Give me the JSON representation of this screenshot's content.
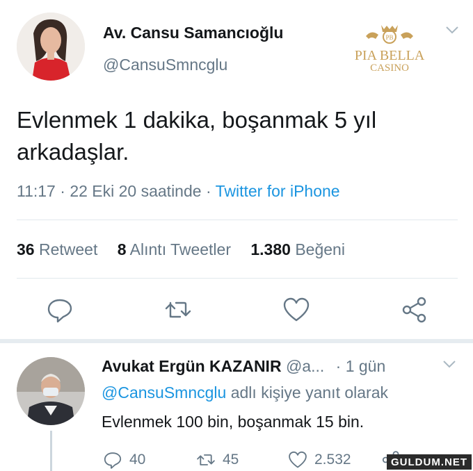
{
  "colors": {
    "link": "#1b95e0",
    "secondary": "#657786",
    "primary": "#14171a",
    "divider": "#e1e8ed"
  },
  "tweet": {
    "author_name": "Av. Cansu Samancıoğlu",
    "author_handle": "@CansuSmncglu",
    "text": "Evlenmek 1 dakika, boşanmak 5 yıl arkadaşlar.",
    "time": "11:17",
    "date": "22 Eki 20 saatinde",
    "separator": "·",
    "source": "Twitter for iPhone",
    "stats": {
      "retweet_count": "36",
      "retweet_label": "Retweet",
      "quote_count": "8",
      "quote_label": "Alıntı Tweetler",
      "like_count": "1.380",
      "like_label": "Beğeni"
    },
    "actions": [
      {
        "icon": "reply-icon"
      },
      {
        "icon": "retweet-icon"
      },
      {
        "icon": "like-icon"
      },
      {
        "icon": "share-icon"
      }
    ]
  },
  "logo": {
    "top": "PIA BELLA",
    "bottom": "CASINO",
    "badge": "PB"
  },
  "reply": {
    "author_name": "Avukat Ergün KAZANIR",
    "author_handle": "@a...",
    "time_ago": "· 1 gün",
    "reply_to_mention": "@CansuSmncglu",
    "reply_to_suffix": "adlı kişiye yanıt olarak",
    "text": "Evlenmek 100 bin, boşanmak 15 bin.",
    "reply_count": "40",
    "retweet_count": "45",
    "like_count": "2.532"
  },
  "watermark": "GULDUM.NET",
  "icons": [
    "chevron-down-icon",
    "reply-icon",
    "retweet-icon",
    "like-icon",
    "share-icon"
  ]
}
